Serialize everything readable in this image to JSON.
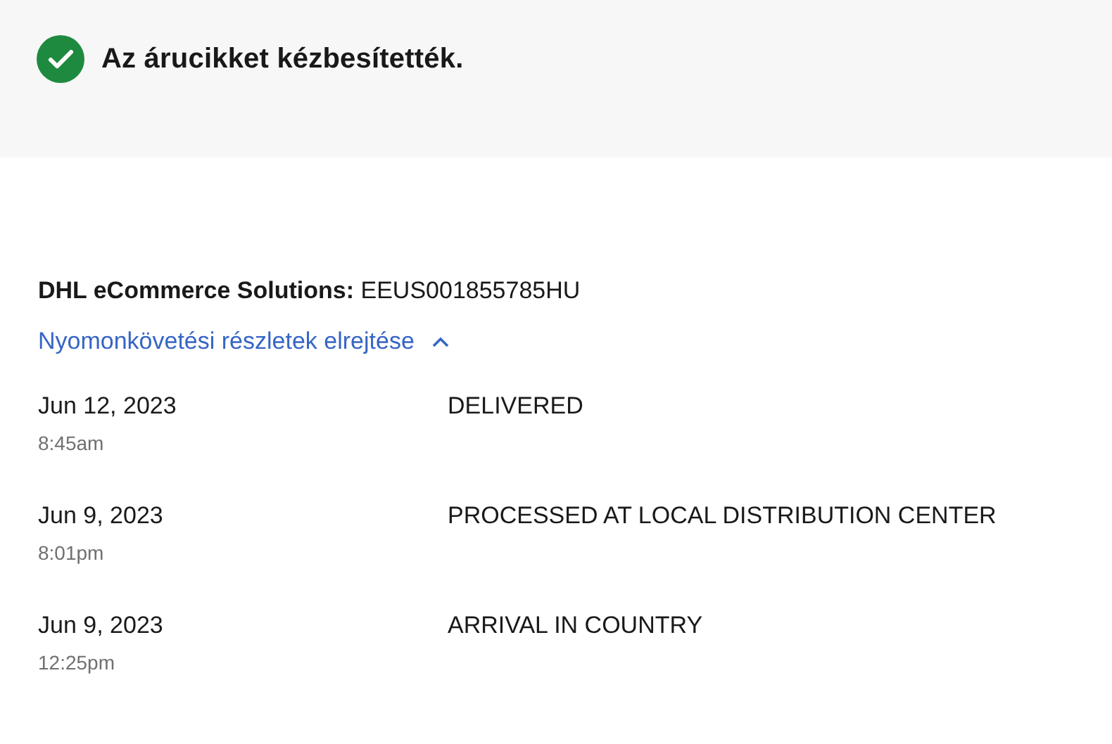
{
  "status_banner": {
    "message": "Az árucikket kézbesítették.",
    "delivered": true
  },
  "shipment": {
    "carrier_line": "**DHL eCommerce Solutions:** EEUS001855785HU",
    "toggle_label": "Nyomonkövetési részletek elrejtése",
    "expanded": true
  },
  "events": [
    {
      "date": "Jun 12, 2023",
      "time": "8:45am",
      "status": "DELIVERED"
    },
    {
      "date": "Jun 9, 2023",
      "time": "8:01pm",
      "status": "PROCESSED AT LOCAL DISTRIBUTION CENTER"
    },
    {
      "date": "Jun 9, 2023",
      "time": "12:25pm",
      "status": "ARRIVAL IN COUNTRY"
    }
  ]
}
